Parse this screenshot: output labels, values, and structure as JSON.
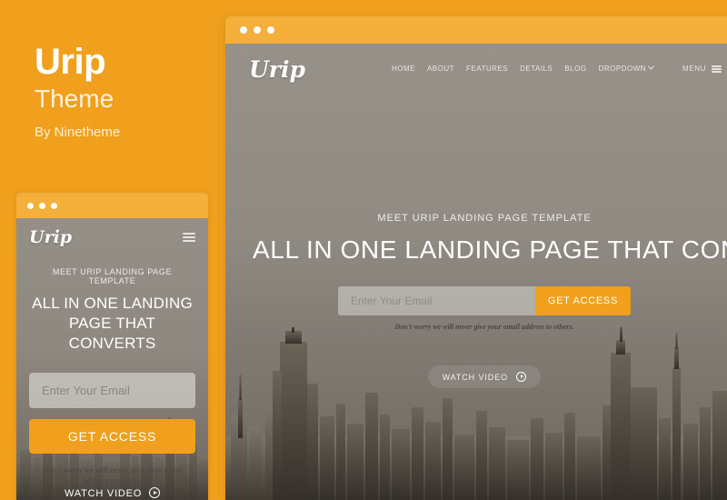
{
  "intro": {
    "title": "Urip",
    "subtitle": "Theme",
    "author": "By Ninetheme"
  },
  "colors": {
    "brand_orange": "#F0A01C",
    "titlebar_orange": "#F4B03B",
    "hero_overlay": "#8D8880"
  },
  "browser_window": {
    "titlebar_dots": 3,
    "nav": {
      "logo": "Urip",
      "links": [
        {
          "label": "HOME"
        },
        {
          "label": "ABOUT"
        },
        {
          "label": "FEATURES"
        },
        {
          "label": "DETAILS"
        },
        {
          "label": "BLOG"
        },
        {
          "label": "DROPDOWN",
          "has_chevron": true
        }
      ],
      "menu_label": "MENU",
      "menu_icon": "hamburger-icon"
    },
    "hero": {
      "eyebrow": "MEET URIP LANDING PAGE TEMPLATE",
      "headline": "ALL IN ONE LANDING PAGE THAT CONVERTS",
      "email_placeholder": "Enter Your Email",
      "email_value": "",
      "cta_label": "GET ACCESS",
      "disclaimer": "Don't worry we will never give your email address to others.",
      "watch_label": "WATCH VIDEO",
      "watch_icon": "play-circle-icon"
    }
  },
  "mobile_window": {
    "titlebar_dots": 3,
    "nav": {
      "logo": "Urip",
      "menu_icon": "hamburger-icon"
    },
    "hero": {
      "eyebrow": "MEET URIP LANDING PAGE TEMPLATE",
      "headline": "ALL IN ONE LANDING PAGE THAT CONVERTS",
      "email_placeholder": "Enter Your Email",
      "email_value": "",
      "cta_label": "GET ACCESS",
      "disclaimer": "Don't worry we will never give your email address to others.",
      "watch_label": "WATCH VIDEO",
      "watch_icon": "play-circle-icon"
    }
  }
}
